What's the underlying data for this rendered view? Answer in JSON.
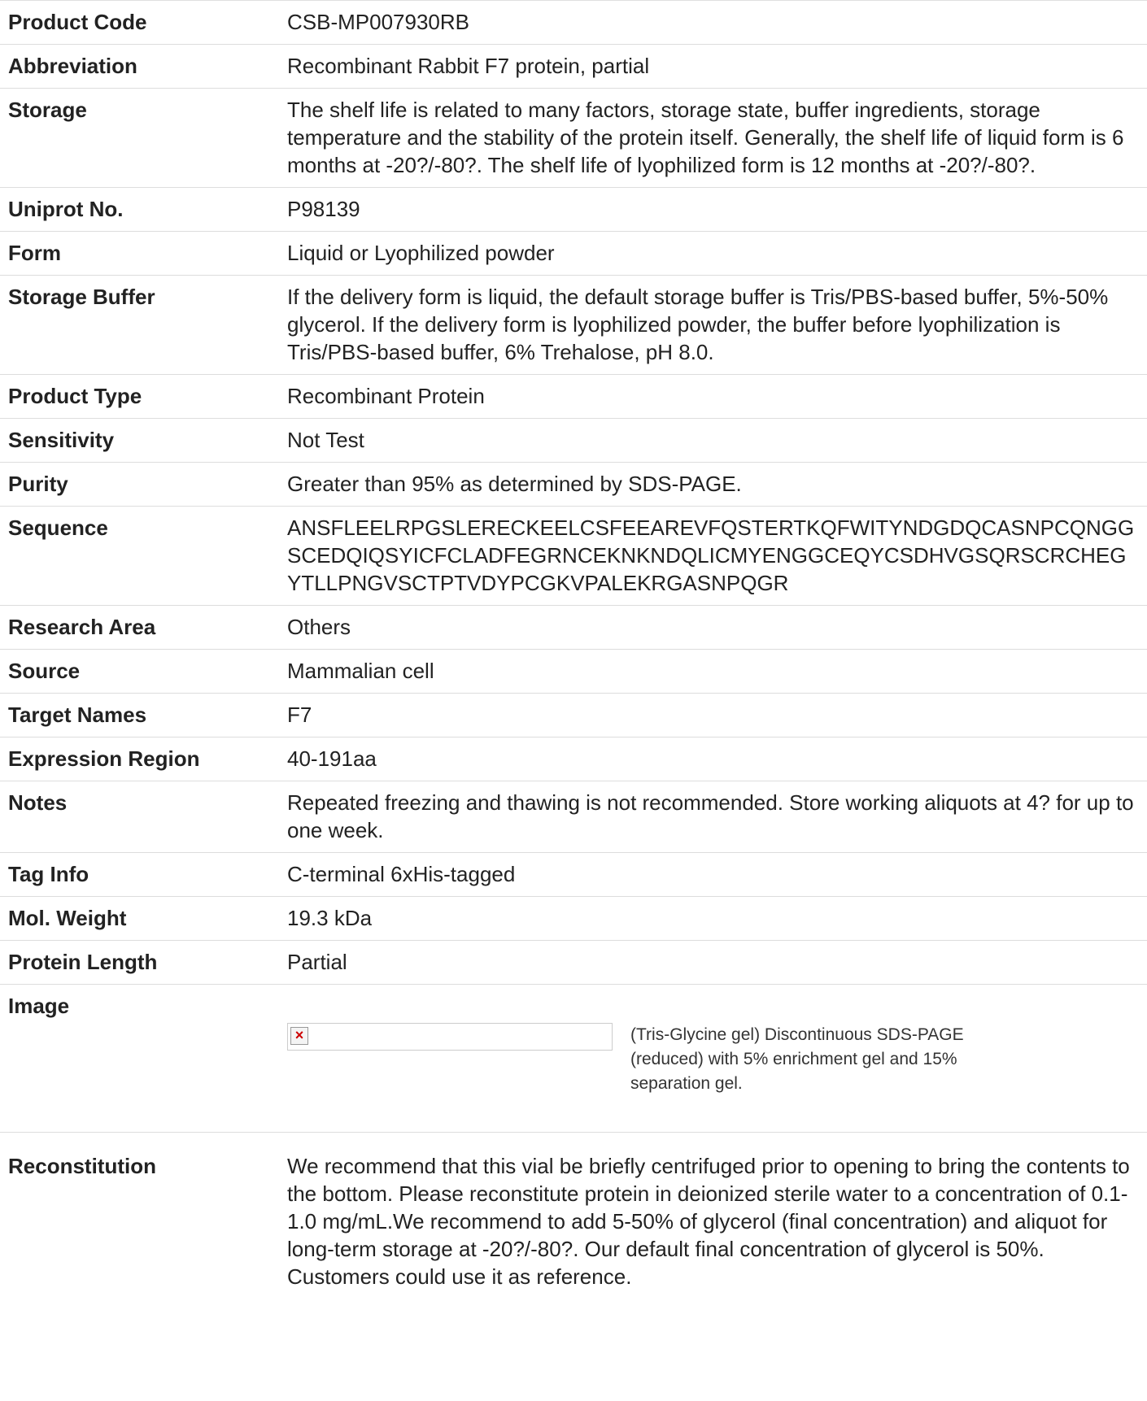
{
  "rows": [
    {
      "label": "Product Code",
      "value": "CSB-MP007930RB"
    },
    {
      "label": "Abbreviation",
      "value": "Recombinant Rabbit F7 protein, partial"
    },
    {
      "label": "Storage",
      "value": "The shelf life is related to many factors, storage state, buffer ingredients, storage temperature and the stability of the protein itself. Generally, the shelf life of liquid form is 6 months at -20?/-80?. The shelf life of lyophilized form is 12 months at -20?/-80?."
    },
    {
      "label": "Uniprot No.",
      "value": "P98139"
    },
    {
      "label": "Form",
      "value": "Liquid or Lyophilized powder"
    },
    {
      "label": "Storage Buffer",
      "value": "If the delivery form is liquid, the default storage buffer is Tris/PBS-based buffer, 5%-50% glycerol. If the delivery form is lyophilized powder, the buffer before lyophilization is Tris/PBS-based buffer, 6% Trehalose, pH 8.0."
    },
    {
      "label": "Product Type",
      "value": "Recombinant Protein"
    },
    {
      "label": "Sensitivity",
      "value": "Not Test"
    },
    {
      "label": "Purity",
      "value": "Greater than 95% as determined by SDS-PAGE."
    },
    {
      "label": "Sequence",
      "value": "ANSFLEELRPGSLERECKEELCSFEEAREVFQSTERTKQFWITYNDGDQCASNPCQNGGSCEDQIQSYICFCLADFEGRNCEKNKNDQLICMYENGGCEQYCSDHVGSQRSCRCHEGYTLLPNGVSCTPTVDYPCGKVPALEKRGASNPQGR"
    },
    {
      "label": "Research Area",
      "value": "Others"
    },
    {
      "label": "Source",
      "value": "Mammalian cell"
    },
    {
      "label": "Target Names",
      "value": "F7"
    },
    {
      "label": "Expression Region",
      "value": "40-191aa"
    },
    {
      "label": "Notes",
      "value": "Repeated freezing and thawing is not recommended. Store working aliquots at 4? for up to one week."
    },
    {
      "label": "Tag Info",
      "value": "C-terminal 6xHis-tagged"
    },
    {
      "label": "Mol. Weight",
      "value": "19.3 kDa"
    },
    {
      "label": "Protein Length",
      "value": "Partial"
    }
  ],
  "image_row": {
    "label": "Image",
    "broken_icon_glyph": "×",
    "caption": "(Tris-Glycine gel) Discontinuous SDS-PAGE (reduced) with 5% enrichment gel and 15% separation gel."
  },
  "reconstitution": {
    "label": "Reconstitution",
    "value": "We recommend that this vial be briefly centrifuged prior to opening to bring the contents to the bottom. Please reconstitute protein in deionized sterile water to a concentration of 0.1-1.0 mg/mL.We recommend to add 5-50% of glycerol (final concentration) and aliquot for long-term storage at -20?/-80?. Our default final concentration of glycerol is 50%. Customers could use it as reference."
  }
}
